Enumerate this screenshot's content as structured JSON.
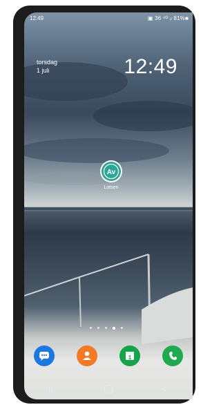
{
  "status_bar": {
    "time": "12:49",
    "icons_text": "▣ 36 ⁴ᴳ ᵢₗ 81%■"
  },
  "lock": {
    "day": "torsdag",
    "date": "1 juli",
    "clock": "12:49"
  },
  "home_app": {
    "label": "Lotsen",
    "icon": "lotsen-av-icon",
    "icon_text": "Av",
    "color": "#2aa596"
  },
  "page_indicator": {
    "count": 5,
    "active_index": 3
  },
  "dock": [
    {
      "name": "messages-icon",
      "color": "#1b78e0"
    },
    {
      "name": "contacts-icon",
      "color": "#f07a26"
    },
    {
      "name": "calendar-icon",
      "color": "#16a34a",
      "text": "1"
    },
    {
      "name": "phone-icon",
      "color": "#1faa50"
    }
  ],
  "nav_bar": {
    "recents": "|||",
    "home": "◯",
    "back": "‹"
  }
}
